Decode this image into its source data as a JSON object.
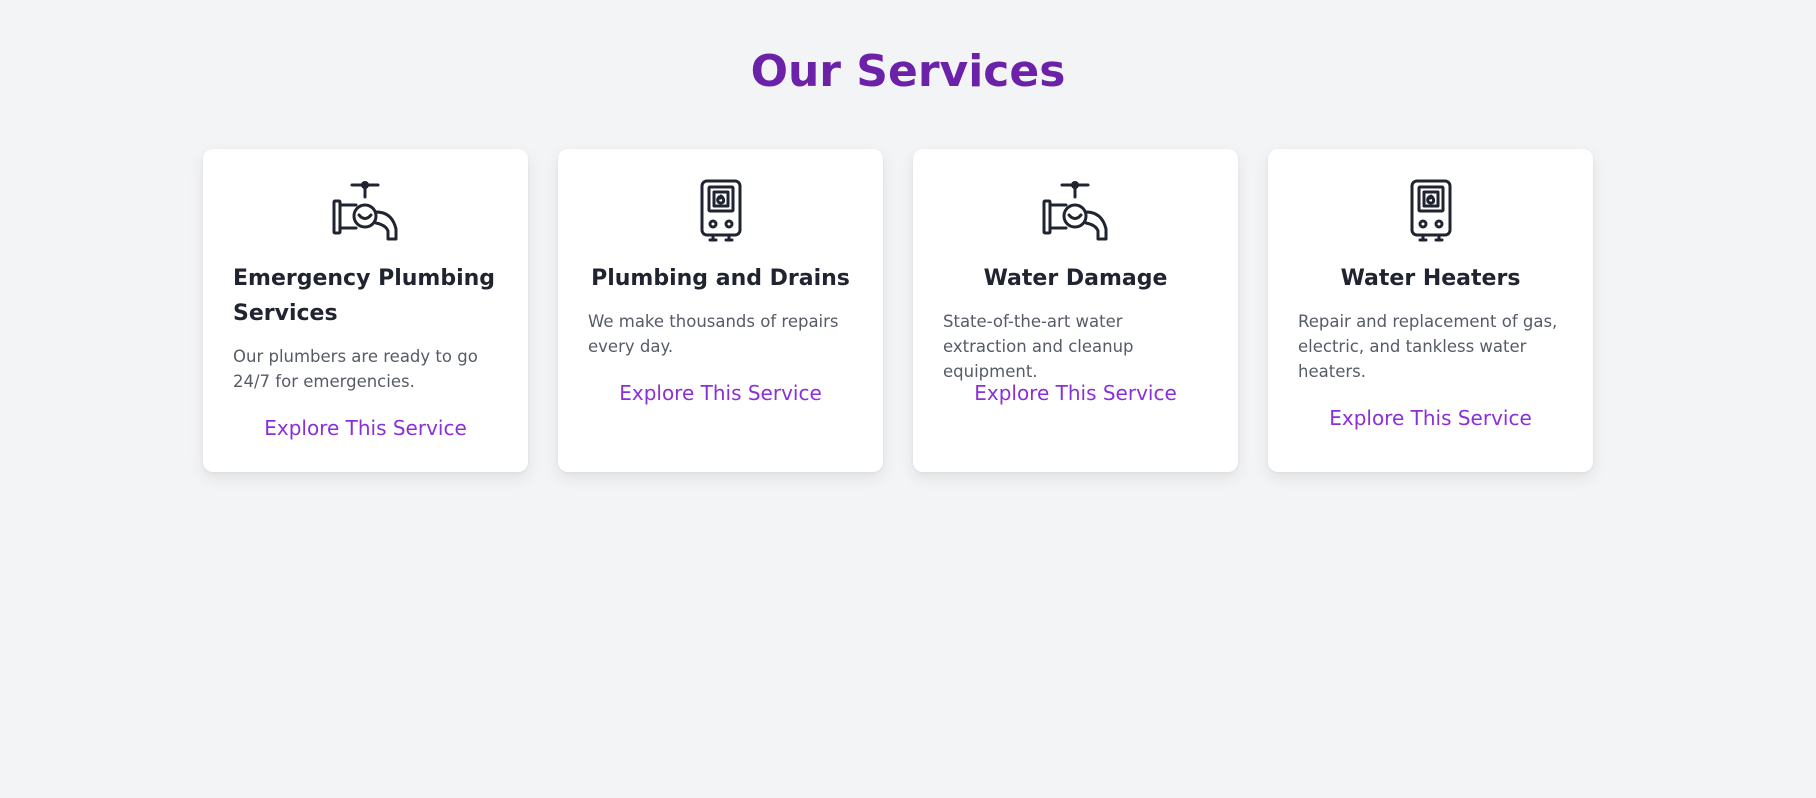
{
  "section": {
    "title": "Our Services"
  },
  "colors": {
    "background": "#f3f4f6",
    "title": "#6b21a8",
    "link": "#8b2fd6",
    "card": "#ffffff",
    "card_title": "#1f2430",
    "card_text": "#565b66",
    "icon_stroke": "#1f2430"
  },
  "services": [
    {
      "icon": "faucet-icon",
      "title": "Emergency Plumbing Services",
      "description": "Our plumbers are ready to go 24/7 for emergencies.",
      "link": "Explore This Service"
    },
    {
      "icon": "water-heater-icon",
      "title": "Plumbing and Drains",
      "description": "We make thousands of repairs every day.",
      "link": "Explore This Service"
    },
    {
      "icon": "faucet-icon",
      "title": "Water Damage",
      "description": "State-of-the-art water extraction and cleanup equipment.",
      "link": "Explore This Service"
    },
    {
      "icon": "water-heater-icon",
      "title": "Water Heaters",
      "description": "Repair and replacement of gas, electric, and tankless water heaters.",
      "link": "Explore This Service"
    }
  ]
}
